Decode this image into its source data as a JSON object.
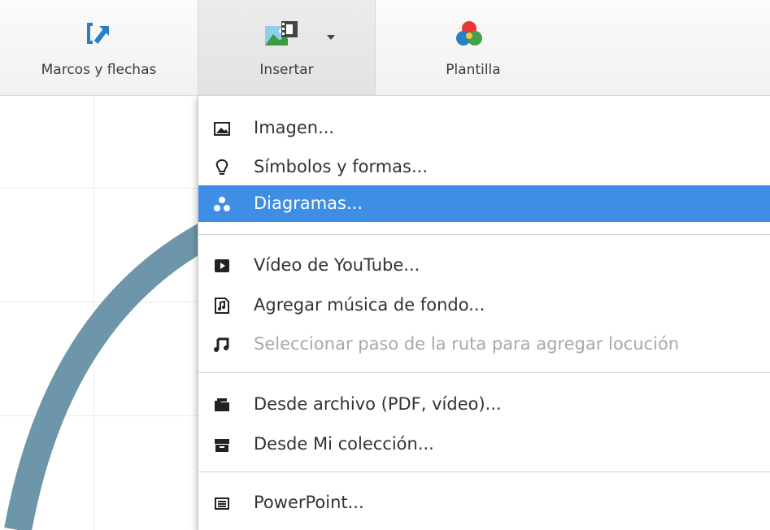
{
  "toolbar": {
    "items": [
      {
        "label": "Marcos y flechas",
        "icon": "frame-arrow-icon"
      },
      {
        "label": "Insertar",
        "icon": "insert-media-icon",
        "has_dropdown": true,
        "pressed": true
      },
      {
        "label": "Plantilla",
        "icon": "color-theme-icon"
      }
    ]
  },
  "menu": {
    "items": [
      {
        "label": "Imagen...",
        "icon": "image-icon"
      },
      {
        "label": "Símbolos y formas...",
        "icon": "lightbulb-icon"
      },
      {
        "label": "Diagramas...",
        "icon": "diagram-icon",
        "highlighted": true
      },
      {
        "label": "Vídeo de YouTube...",
        "icon": "youtube-play-icon"
      },
      {
        "label": "Agregar música de fondo...",
        "icon": "music-file-icon"
      },
      {
        "label": "Seleccionar paso de la ruta para agregar locución",
        "icon": "music-note-icon",
        "disabled": true
      },
      {
        "label": "Desde archivo (PDF, vídeo)...",
        "icon": "folder-icon"
      },
      {
        "label": "Desde Mi colección...",
        "icon": "archive-box-icon"
      },
      {
        "label": "PowerPoint...",
        "icon": "powerpoint-icon"
      }
    ]
  },
  "colors": {
    "highlight": "#3f8ee6",
    "arc": "#6e96aa",
    "brand_blue": "#2a7fc1"
  }
}
